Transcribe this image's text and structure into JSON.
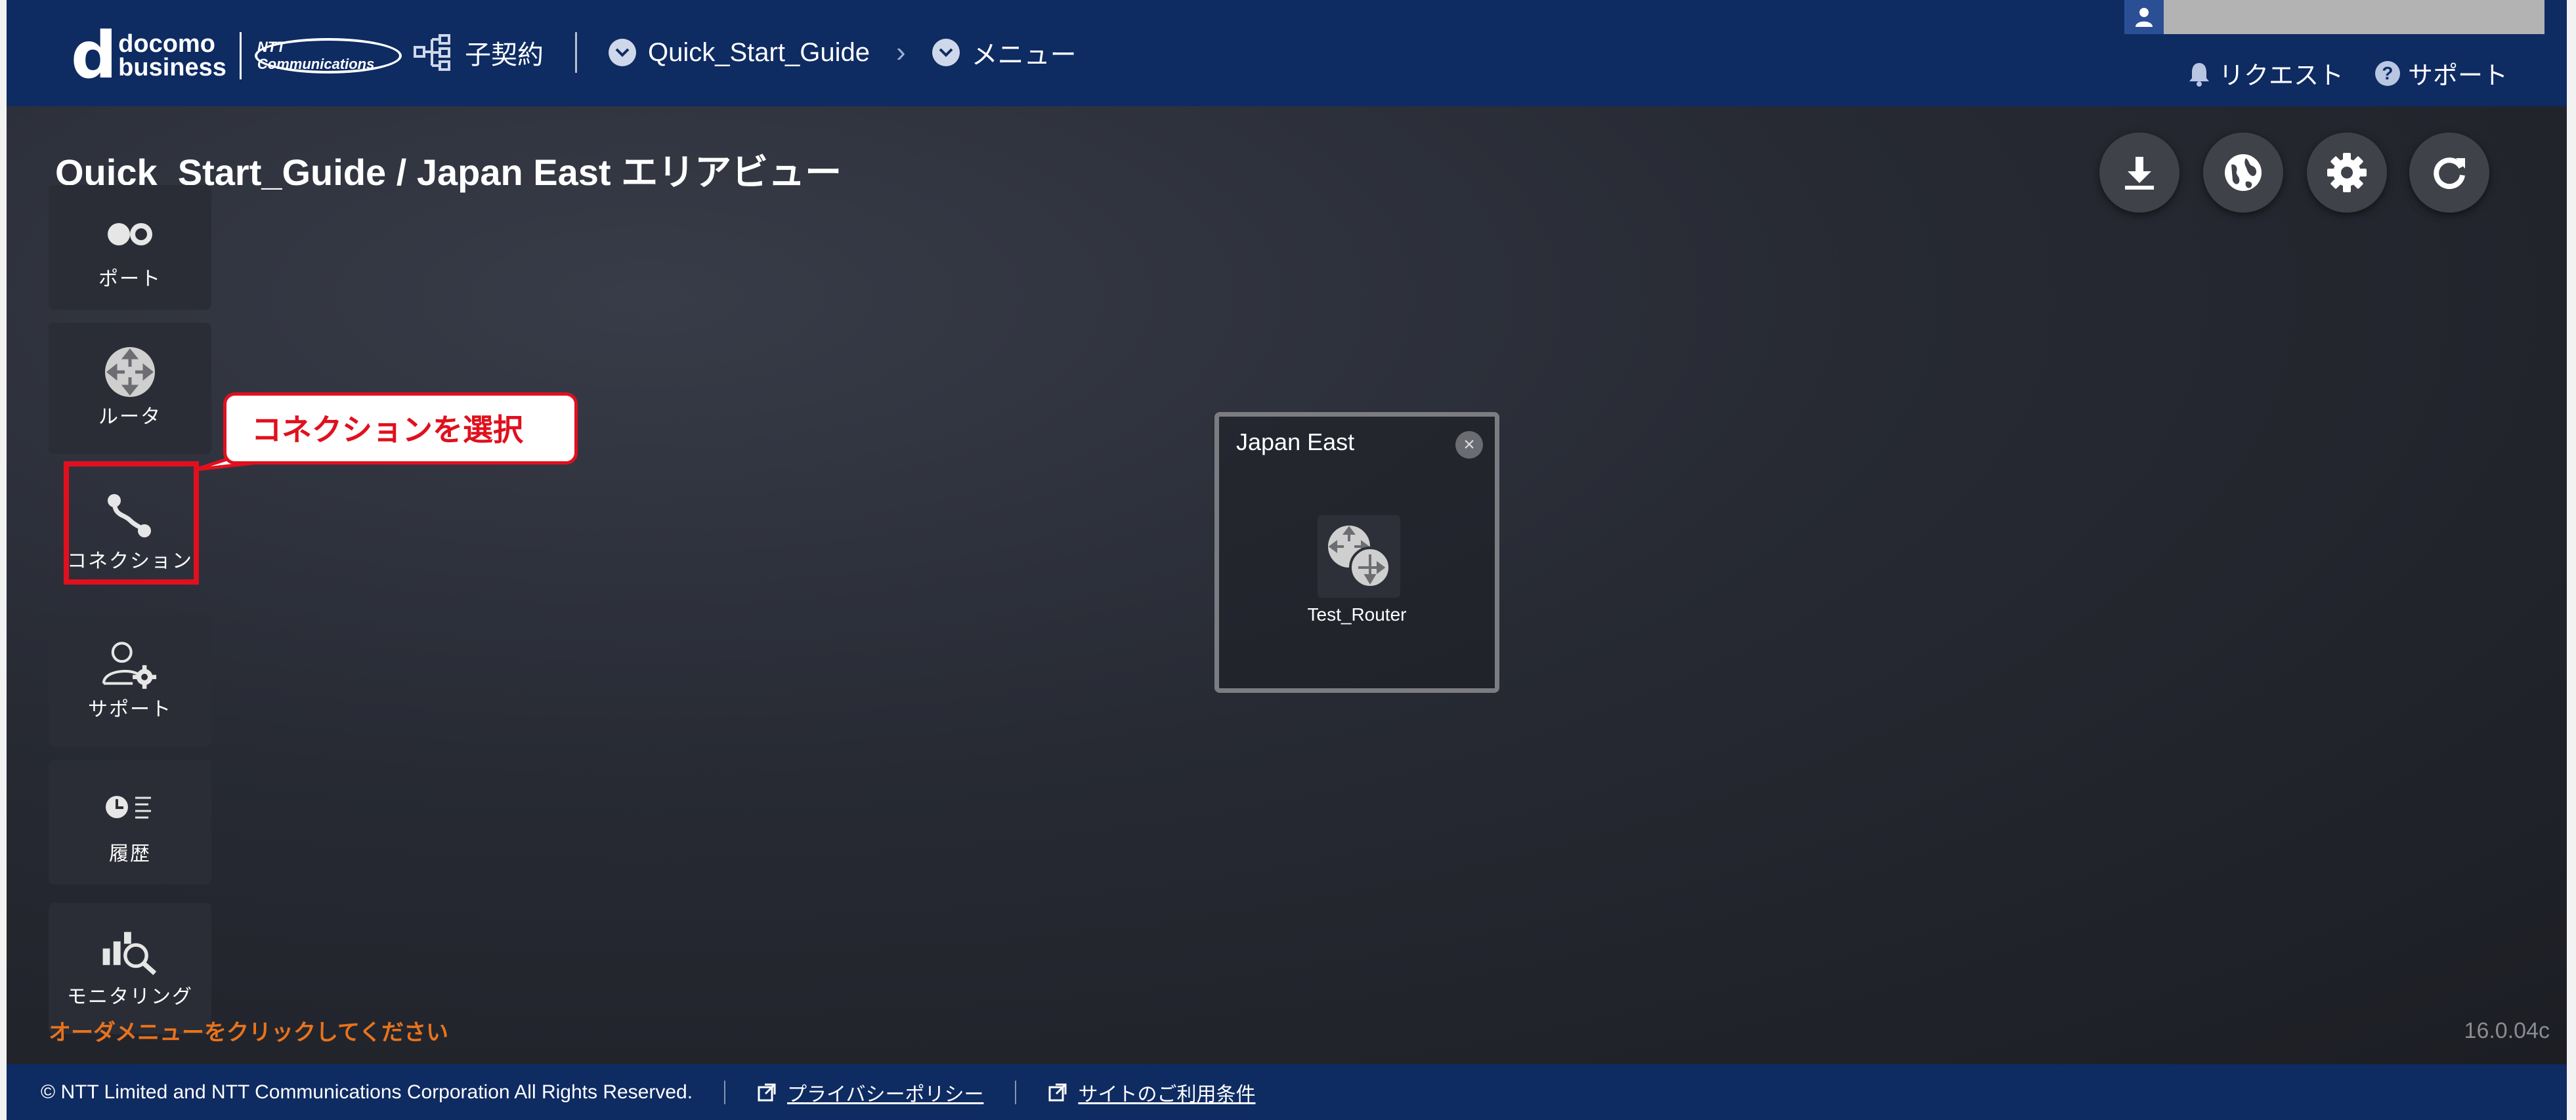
{
  "header": {
    "logo": {
      "mark": "d",
      "line1": "docomo",
      "line2": "business",
      "partner": "NTT Communications"
    },
    "contract_label": "子契約",
    "breadcrumb": [
      "Quick_Start_Guide",
      "メニュー"
    ],
    "links": {
      "request": "リクエスト",
      "support": "サポート"
    }
  },
  "page": {
    "title": "Quick_Start_Guide / Japan East エリアビュー"
  },
  "sidebar": {
    "items": [
      {
        "label": "ポート",
        "icon": "port-icon"
      },
      {
        "label": "ルータ",
        "icon": "router-icon"
      },
      {
        "label": "コネクション",
        "icon": "connection-icon"
      },
      {
        "label": "サポート",
        "icon": "support-icon"
      },
      {
        "label": "履歴",
        "icon": "history-icon"
      },
      {
        "label": "モニタリング",
        "icon": "monitoring-icon"
      }
    ]
  },
  "annotation": {
    "callout": "コネクションを選択",
    "highlight_color": "#e0101e"
  },
  "toolbar": [
    "download-icon",
    "globe-icon",
    "gear-icon",
    "refresh-icon"
  ],
  "area": {
    "title": "Japan East",
    "router_label": "Test_Router"
  },
  "hint": "オーダメニューをクリックしてください",
  "version": "16.0.04c",
  "footer": {
    "copyright": "© NTT Limited and NTT Communications Corporation All Rights Reserved.",
    "privacy": "プライバシーポリシー",
    "terms": "サイトのご利用条件"
  },
  "colors": {
    "header": "#0e2b62",
    "accent": "#e0101e",
    "hint": "#e8731c"
  }
}
